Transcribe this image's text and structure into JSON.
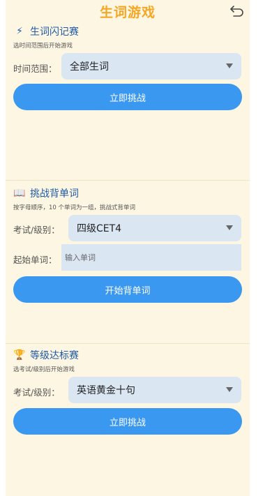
{
  "header": {
    "title": "生词游戏",
    "back_icon": "undo-arrow-icon"
  },
  "sections": [
    {
      "emoji": "⚡",
      "title": "生词闪记赛",
      "subtitle": "选时间范围后开始游戏",
      "row_label": "时间范围：",
      "select_value": "全部生词",
      "button": "立即挑战"
    },
    {
      "emoji": "📖",
      "title": "挑战背单词",
      "subtitle": "按字母顺序，10 个单词为一组，挑战式背单词",
      "row_label": "考试/级别：",
      "select_value": "四级CET4",
      "input_label": "起始单词：",
      "input_placeholder": "输入单词",
      "button": "开始背单词"
    },
    {
      "emoji": "🏆",
      "title": "等级达标赛",
      "subtitle": "选考试/级别后开始游戏",
      "row_label": "考试/级别：",
      "select_value": "英语黄金十句",
      "button": "立即挑战"
    }
  ],
  "colors": {
    "background": "#fdf6e2",
    "title": "#f5a623",
    "section_title": "#1e5aa8",
    "button": "#3b98f0",
    "field": "#dbe6f3"
  }
}
